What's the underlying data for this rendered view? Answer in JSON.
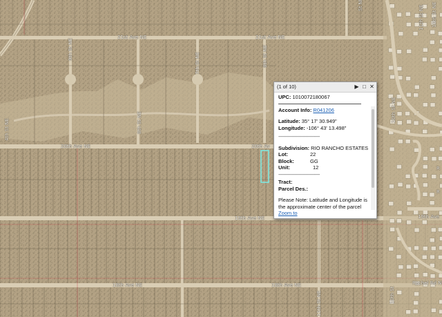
{
  "map": {
    "road_labels": {
      "ave21_a": "21st Ave NE",
      "ave21_b": "21st Ave NE",
      "ave20_a": "20th Ave NE",
      "ave20_b": "20th Av",
      "ave19": "19th Ave NE",
      "ave18_a": "18th Ave NE",
      "ave18_b": "18th Ave NE",
      "st9": "9th St NE",
      "st8": "8th St NE",
      "st8b": "8th St NE",
      "st7": "7th St NE",
      "st10": "10th St NE",
      "st11": "11th St NE",
      "st11b": "11th St NE",
      "st4": "4th St NE",
      "st_top": "St NE",
      "st_right1": "10th St NE",
      "right_19th": "19th Ave",
      "rachel": "Rachel Rd NE",
      "right_r1": "R",
      "right_r2": "R",
      "st_bottom_right": "10th St"
    }
  },
  "popup": {
    "counter": "(1 of 10)",
    "controls": {
      "next": "▶",
      "maximize": "□",
      "close": "✕"
    },
    "upc_label": "UPC:",
    "upc_value": "1010072180067",
    "account_label": "Account Info:",
    "account_value": "R041206",
    "latitude_label": "Latitude:",
    "latitude_value": "35° 17' 30.949\"",
    "longitude_label": "Longitude:",
    "longitude_value": "-106° 43' 13.498\"",
    "separator": "------------------------------",
    "subdivision_label": "Subdivision:",
    "subdivision_value": "RIO RANCHO ESTATES",
    "lot_label": "Lot:",
    "lot_value": "22",
    "block_label": "Block:",
    "block_value": "GG",
    "unit_label": "Unit:",
    "unit_value": "12",
    "tract_label": "Tract:",
    "parcel_label": "Parcel Des.:",
    "note": "Please Note: Latitude and Longitude is the approximate center of the parcel shown.",
    "zoom_link": "Zoom to"
  },
  "colors": {
    "desert": "#b3a284",
    "parcel_line": "#6e6450",
    "road": "#d9cdb4",
    "highlight": "#7fe8e0",
    "link": "#1a5fb4"
  }
}
